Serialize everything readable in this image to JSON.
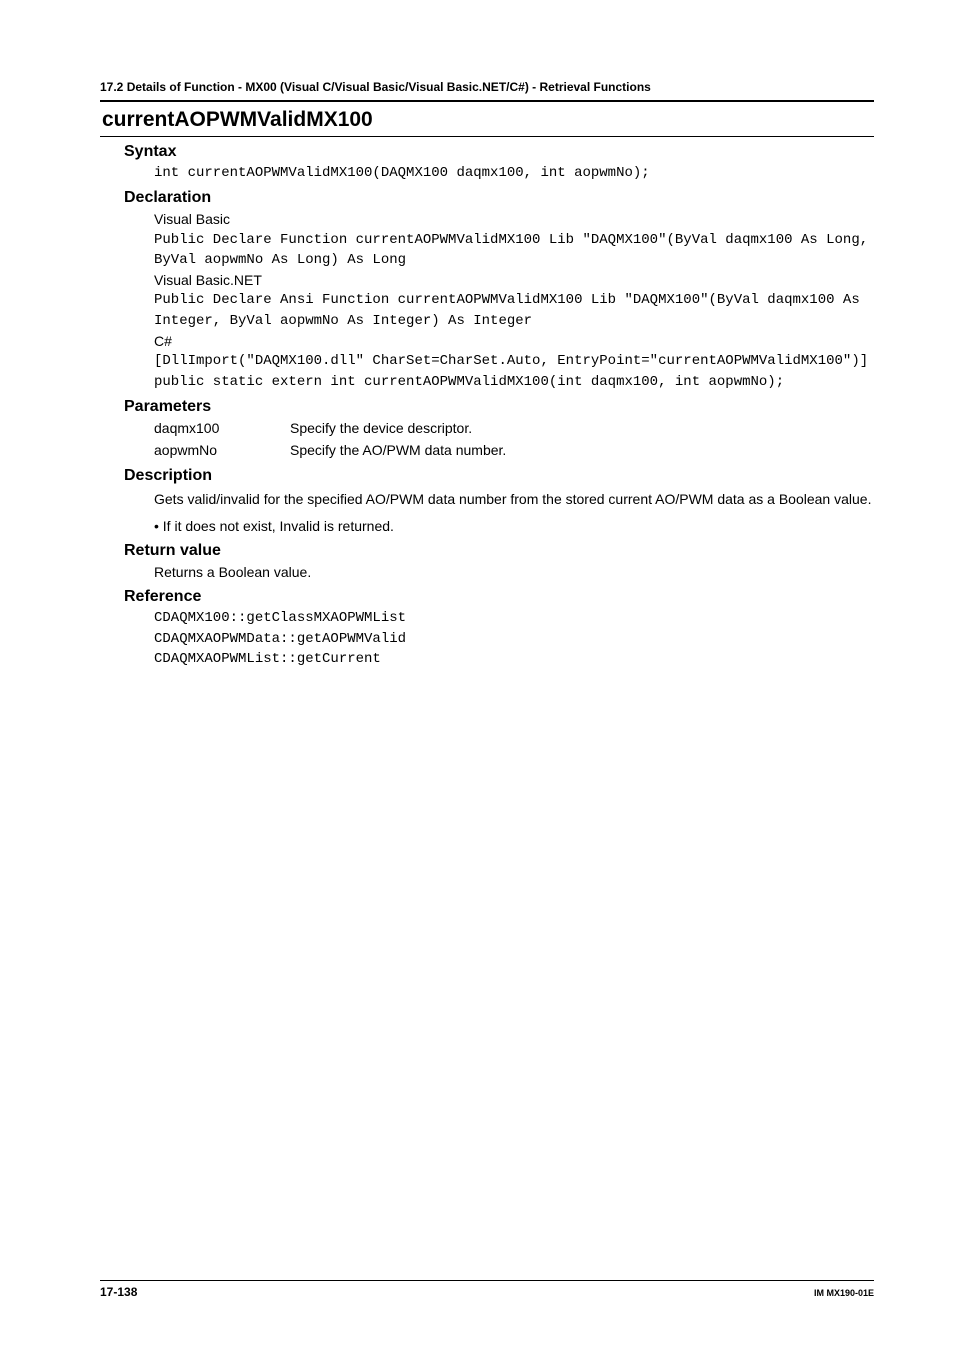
{
  "header": "17.2  Details of  Function - MX00 (Visual C/Visual Basic/Visual Basic.NET/C#) - Retrieval Functions",
  "title": "currentAOPWMValidMX100",
  "sections": {
    "syntax": {
      "heading": "Syntax",
      "code": "int currentAOPWMValidMX100(DAQMX100 daqmx100, int aopwmNo);"
    },
    "declaration": {
      "heading": "Declaration",
      "vb_label": "Visual Basic",
      "vb_code": "Public Declare Function currentAOPWMValidMX100 Lib \"DAQMX100\"(ByVal daqmx100 As Long, ByVal aopwmNo As Long) As Long",
      "vbnet_label": "Visual Basic.NET",
      "vbnet_code": "Public Declare Ansi Function currentAOPWMValidMX100 Lib \"DAQMX100\"(ByVal daqmx100 As Integer, ByVal aopwmNo As Integer) As Integer",
      "cs_label": "C#",
      "cs_code": "[DllImport(\"DAQMX100.dll\" CharSet=CharSet.Auto, EntryPoint=\"currentAOPWMValidMX100\")]\npublic static extern int currentAOPWMValidMX100(int daqmx100, int aopwmNo);"
    },
    "parameters": {
      "heading": "Parameters",
      "rows": [
        {
          "name": "daqmx100",
          "desc": "Specify the device descriptor."
        },
        {
          "name": "aopwmNo",
          "desc": "Specify the AO/PWM data number."
        }
      ]
    },
    "description": {
      "heading": "Description",
      "text": "Gets valid/invalid for the specified AO/PWM data number from the stored current AO/PWM data as a Boolean value.",
      "bullet": "If it does not exist, Invalid is returned."
    },
    "return": {
      "heading": "Return value",
      "text": "Returns a Boolean value."
    },
    "reference": {
      "heading": "Reference",
      "code": "CDAQMX100::getClassMXAOPWMList\nCDAQMXAOPWMData::getAOPWMValid\nCDAQMXAOPWMList::getCurrent"
    }
  },
  "footer": {
    "page": "17-138",
    "doc": "IM MX190-01E"
  }
}
